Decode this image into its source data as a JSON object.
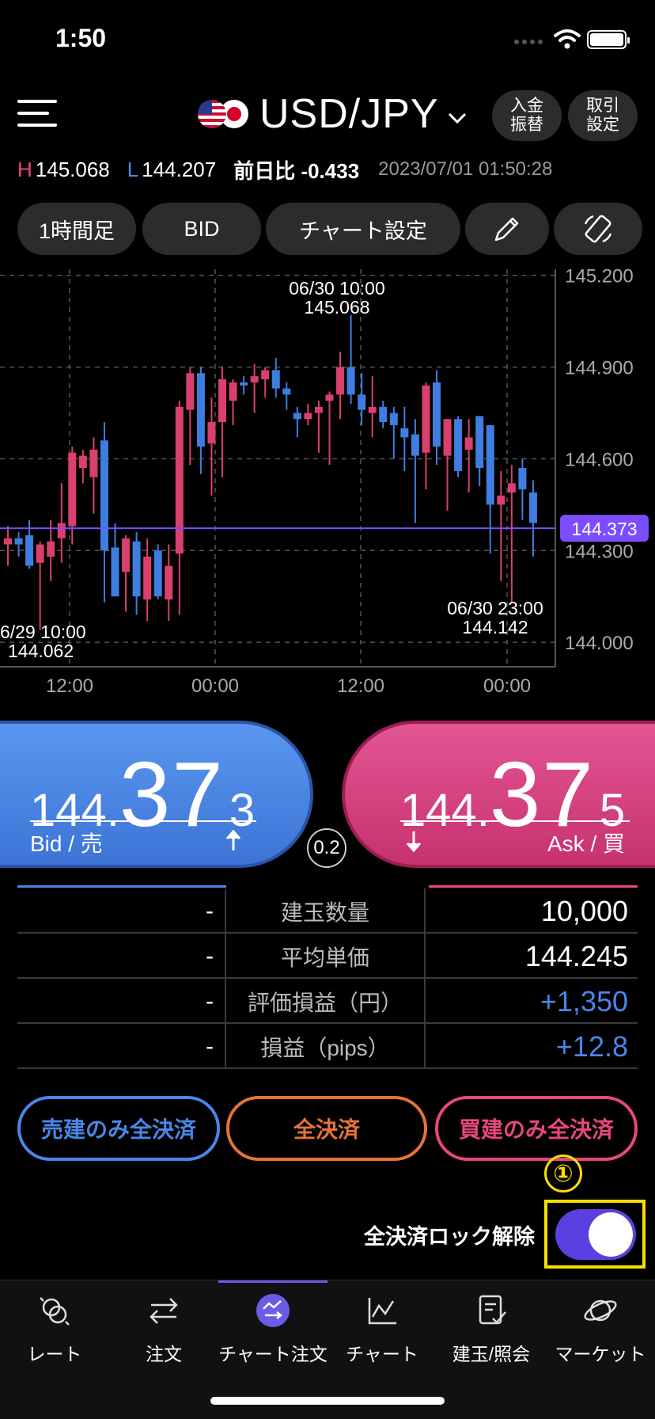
{
  "status_bar": {
    "time": "1:50"
  },
  "header": {
    "pair": "USD/JPY",
    "deposit_button": "入金\n振替",
    "trade_settings_button": "取引\n設定"
  },
  "price_info": {
    "high_label": "H",
    "high": "145.068",
    "low_label": "L",
    "low": "144.207",
    "change": "前日比 -0.433",
    "timestamp": "2023/07/01 01:50:28"
  },
  "toolbar": {
    "timeframe": "1時間足",
    "price_type": "BID",
    "chart_settings": "チャート設定"
  },
  "chart_data": {
    "type": "candlestick",
    "x_ticks": [
      "12:00",
      "00:00",
      "12:00",
      "00:00"
    ],
    "y_ticks": [
      "145.200",
      "144.900",
      "144.600",
      "144.300",
      "144.000"
    ],
    "ylim": [
      143.92,
      145.22
    ],
    "current_price": "144.373",
    "annotations": {
      "high_time": "06/30 10:00",
      "high_value": "145.068",
      "low_time": "6/29 10:00",
      "low_value": "144.062",
      "last_low_time": "06/30 23:00",
      "last_low_value": "144.142"
    },
    "candles": [
      {
        "o": 144.32,
        "h": 144.38,
        "l": 144.25,
        "c": 144.34
      },
      {
        "o": 144.34,
        "h": 144.36,
        "l": 144.28,
        "c": 144.32
      },
      {
        "o": 144.35,
        "h": 144.4,
        "l": 144.24,
        "c": 144.25
      },
      {
        "o": 144.26,
        "h": 144.33,
        "l": 144.04,
        "c": 144.32
      },
      {
        "o": 144.28,
        "h": 144.4,
        "l": 144.2,
        "c": 144.33
      },
      {
        "o": 144.34,
        "h": 144.52,
        "l": 144.26,
        "c": 144.39
      },
      {
        "o": 144.38,
        "h": 144.64,
        "l": 144.32,
        "c": 144.62
      },
      {
        "o": 144.57,
        "h": 144.63,
        "l": 144.52,
        "c": 144.61
      },
      {
        "o": 144.54,
        "h": 144.67,
        "l": 144.42,
        "c": 144.63
      },
      {
        "o": 144.66,
        "h": 144.72,
        "l": 144.13,
        "c": 144.3
      },
      {
        "o": 144.31,
        "h": 144.39,
        "l": 144.18,
        "c": 144.15
      },
      {
        "o": 144.23,
        "h": 144.35,
        "l": 144.1,
        "c": 144.34
      },
      {
        "o": 144.33,
        "h": 144.36,
        "l": 144.09,
        "c": 144.15
      },
      {
        "o": 144.14,
        "h": 144.34,
        "l": 144.07,
        "c": 144.28
      },
      {
        "o": 144.3,
        "h": 144.32,
        "l": 144.14,
        "c": 144.15
      },
      {
        "o": 144.14,
        "h": 144.32,
        "l": 144.07,
        "c": 144.25
      },
      {
        "o": 144.29,
        "h": 144.79,
        "l": 144.09,
        "c": 144.77
      },
      {
        "o": 144.76,
        "h": 144.9,
        "l": 144.58,
        "c": 144.88
      },
      {
        "o": 144.88,
        "h": 144.9,
        "l": 144.55,
        "c": 144.64
      },
      {
        "o": 144.65,
        "h": 144.8,
        "l": 144.48,
        "c": 144.72
      },
      {
        "o": 144.72,
        "h": 144.9,
        "l": 144.54,
        "c": 144.86
      },
      {
        "o": 144.79,
        "h": 144.86,
        "l": 144.71,
        "c": 144.85
      },
      {
        "o": 144.85,
        "h": 144.87,
        "l": 144.81,
        "c": 144.84
      },
      {
        "o": 144.85,
        "h": 144.91,
        "l": 144.75,
        "c": 144.87
      },
      {
        "o": 144.86,
        "h": 144.9,
        "l": 144.8,
        "c": 144.89
      },
      {
        "o": 144.89,
        "h": 144.93,
        "l": 144.8,
        "c": 144.83
      },
      {
        "o": 144.83,
        "h": 144.85,
        "l": 144.76,
        "c": 144.81
      },
      {
        "o": 144.75,
        "h": 144.77,
        "l": 144.67,
        "c": 144.73
      },
      {
        "o": 144.73,
        "h": 144.78,
        "l": 144.71,
        "c": 144.75
      },
      {
        "o": 144.75,
        "h": 144.79,
        "l": 144.62,
        "c": 144.77
      },
      {
        "o": 144.79,
        "h": 144.82,
        "l": 144.58,
        "c": 144.81
      },
      {
        "o": 144.81,
        "h": 144.95,
        "l": 144.73,
        "c": 144.9
      },
      {
        "o": 144.9,
        "h": 145.07,
        "l": 144.78,
        "c": 144.81
      },
      {
        "o": 144.81,
        "h": 144.88,
        "l": 144.71,
        "c": 144.76
      },
      {
        "o": 144.75,
        "h": 144.87,
        "l": 144.67,
        "c": 144.77
      },
      {
        "o": 144.77,
        "h": 144.79,
        "l": 144.7,
        "c": 144.72
      },
      {
        "o": 144.75,
        "h": 144.77,
        "l": 144.6,
        "c": 144.71
      },
      {
        "o": 144.7,
        "h": 144.77,
        "l": 144.56,
        "c": 144.67
      },
      {
        "o": 144.68,
        "h": 144.73,
        "l": 144.39,
        "c": 144.61
      },
      {
        "o": 144.62,
        "h": 144.85,
        "l": 144.5,
        "c": 144.84
      },
      {
        "o": 144.85,
        "h": 144.89,
        "l": 144.58,
        "c": 144.64
      },
      {
        "o": 144.61,
        "h": 144.73,
        "l": 144.43,
        "c": 144.73
      },
      {
        "o": 144.73,
        "h": 144.74,
        "l": 144.54,
        "c": 144.56
      },
      {
        "o": 144.63,
        "h": 144.73,
        "l": 144.49,
        "c": 144.67
      },
      {
        "o": 144.74,
        "h": 144.74,
        "l": 144.51,
        "c": 144.57
      },
      {
        "o": 144.71,
        "h": 144.71,
        "l": 144.29,
        "c": 144.45
      },
      {
        "o": 144.45,
        "h": 144.56,
        "l": 144.2,
        "c": 144.48
      },
      {
        "o": 144.49,
        "h": 144.58,
        "l": 144.13,
        "c": 144.52
      },
      {
        "o": 144.57,
        "h": 144.6,
        "l": 144.4,
        "c": 144.5
      },
      {
        "o": 144.49,
        "h": 144.53,
        "l": 144.28,
        "c": 144.39
      }
    ]
  },
  "quote": {
    "bid_prefix": "144.",
    "bid_big": "37",
    "bid_last": "3",
    "bid_label": "Bid / 売",
    "ask_prefix": "144.",
    "ask_big": "37",
    "ask_last": "5",
    "ask_label": "Ask / 買",
    "spread": "0.2"
  },
  "positions": [
    {
      "sell": "-",
      "label": "建玉数量",
      "buy": "10,000",
      "color": "#ffffff"
    },
    {
      "sell": "-",
      "label": "平均単価",
      "buy": "144.245",
      "color": "#ffffff"
    },
    {
      "sell": "-",
      "label": "評価損益（円）",
      "buy": "+1,350",
      "color": "#4a86e8"
    },
    {
      "sell": "-",
      "label": "損益（pips）",
      "buy": "+12.8",
      "color": "#4a86e8"
    }
  ],
  "close_buttons": {
    "sell_only": "売建のみ全決済",
    "all": "全決済",
    "buy_only": "買建のみ全決済"
  },
  "marker": "①",
  "lock": {
    "label": "全決済ロック解除",
    "enabled": true
  },
  "tabs": [
    {
      "label": "レート",
      "icon": "rate-icon"
    },
    {
      "label": "注文",
      "icon": "order-arrows-icon"
    },
    {
      "label": "チャート注文",
      "icon": "chart-order-icon",
      "active": true
    },
    {
      "label": "チャート",
      "icon": "line-chart-icon"
    },
    {
      "label": "建玉/照会",
      "icon": "position-inquiry-icon"
    },
    {
      "label": "マーケット",
      "icon": "market-planet-icon"
    }
  ],
  "colors": {
    "bid": "#4a86e8",
    "ask": "#e8477a",
    "up_candle": "#d9406e",
    "down_candle": "#3f7de0",
    "current_line": "#7c4dff",
    "highlight": "#f7e000"
  }
}
